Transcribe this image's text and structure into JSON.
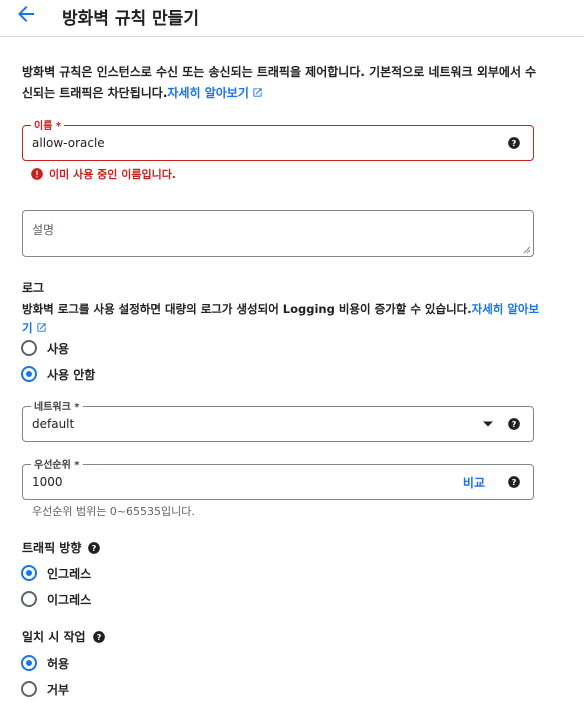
{
  "header": {
    "title": "방화벽 규칙 만들기"
  },
  "intro": {
    "text": "방화벽 규칙은 인스턴스로 수신 또는 송신되는 트래픽을 제어합니다. 기본적으로 네트워크 외부에서 수신되는 트래픽은 차단됩니다.",
    "link": "자세히 알아보기"
  },
  "name_field": {
    "label": "이름",
    "required_mark": "*",
    "value": "allow-oracle",
    "error": "이미 사용 중인 이름입니다."
  },
  "description_field": {
    "label": "설명"
  },
  "logs": {
    "title": "로그",
    "text": "방화벽 로그를 사용 설정하면 대량의 로그가 생성되어 Logging 비용이 증가할 수 있습니다.",
    "link": "자세히 알아보기",
    "options": [
      {
        "label": "사용",
        "checked": false
      },
      {
        "label": "사용 안함",
        "checked": true
      }
    ]
  },
  "network_field": {
    "label": "네트워크",
    "required_mark": "*",
    "value": "default"
  },
  "priority_field": {
    "label": "우선순위",
    "required_mark": "*",
    "value": "1000",
    "compare_label": "비교",
    "hint": "우선순위 범위는 0~65535입니다."
  },
  "direction": {
    "title": "트래픽 방향",
    "options": [
      {
        "label": "인그레스",
        "checked": true
      },
      {
        "label": "이그레스",
        "checked": false
      }
    ]
  },
  "action": {
    "title": "일치 시 작업",
    "options": [
      {
        "label": "허용",
        "checked": true
      },
      {
        "label": "거부",
        "checked": false
      }
    ]
  },
  "colors": {
    "accent": "#1a73e8",
    "error": "#c5221f",
    "text": "#202124",
    "border": "#80868b"
  }
}
